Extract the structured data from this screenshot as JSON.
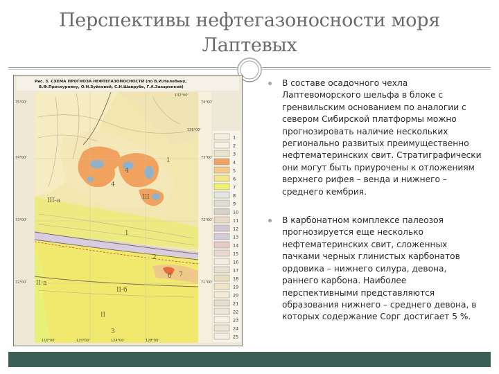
{
  "slide": {
    "title_line1": "Перспективы нефтегазоносности моря",
    "title_line2": "Лаптевых"
  },
  "map": {
    "caption_line1": "Рис. 3. СХЕМА ПРОГНОЗА НЕФТЕГАЗОНОСНОСТИ (по В.И.Нелобину,",
    "caption_line2": "В.Ф.Проскурнину, О.Н.Зуйковой, С.Н.Шаврубе, Г.А.Захаренкой)",
    "zone_labels": [
      "III-а",
      "III",
      "II-а",
      "II-б",
      "II",
      "3",
      "4",
      "4",
      "1",
      "2",
      "7",
      "6",
      "1"
    ],
    "legend_numbers": [
      "1",
      "2",
      "3",
      "4",
      "5",
      "6",
      "7",
      "8",
      "9",
      "10",
      "11",
      "12",
      "13",
      "14",
      "15",
      "16",
      "17",
      "18",
      "19",
      "20",
      "21",
      "22",
      "23",
      "24",
      "25"
    ],
    "legend_colors": [
      "#f3efe0",
      "#f6f3e6",
      "#e9e4cc",
      "#f0a464",
      "#f5c98a",
      "#f2e58a",
      "#eef070",
      "#e6e6e0",
      "#ddddd6",
      "#d6d2c8",
      "#e8d9c8",
      "#cfc9d6",
      "#d3cbdc",
      "#e5c8c8",
      "#e8d8d0",
      "#f1ece2",
      "#e5e0d2",
      "#eadcc0",
      "#efe4c8",
      "#f2ead2",
      "#e4ded0",
      "#ebe6d8",
      "#f4f0e6",
      "#ece6d8",
      "#f2eee4"
    ],
    "coord_labels": [
      "75°00'",
      "74°00'",
      "73°00'",
      "72°00'",
      "74°00'",
      "73°00'",
      "72°00'",
      "71°00'",
      "116°00'",
      "120°00'",
      "124°00'",
      "128°00'",
      "132°00'",
      "136°00'"
    ]
  },
  "bullets": [
    {
      "text": "В составе осадочного чехла Лаптевоморского шельфа в блоке с гренвильским основанием по аналогии с севером Сибирской платформы можно прогнозировать наличие нескольких регионально развитых преимущественно нефтематеринских свит. Стратиграфически они могут быть приурочены к отложениям верхнего рифея – венда и нижнего – среднего кембрия."
    },
    {
      "text": "В карбонатном комплексе палеозоя прогнозируется еще несколько нефтематеринских свит, сложенных пачками черных глинистых карбонатов ордовика – нижнего силура, девона, раннего карбона. Наиболее перспективными представляются образования нижнего – среднего девона, в которых содержание Сорг достигает 5 %."
    }
  ],
  "colors": {
    "title": "#6a6a6a",
    "bottom_bar": "#3b5f55",
    "map_yellow": "#f0e96e",
    "map_orange": "#f2a25f",
    "map_cream": "#f4e6ad",
    "map_blue": "#8fb2cc"
  }
}
